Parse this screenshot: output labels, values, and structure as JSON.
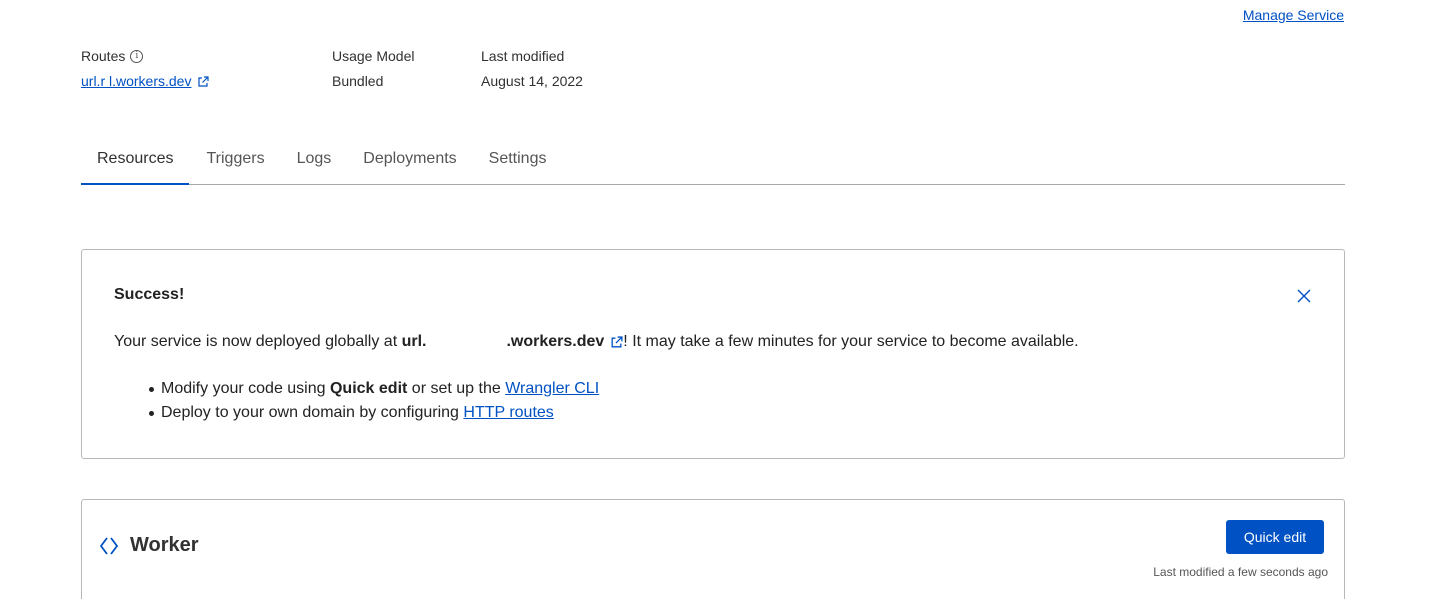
{
  "header": {
    "manage_service": "Manage Service"
  },
  "meta": {
    "routes_label": "Routes",
    "route_value": "url.r       l.workers.dev",
    "usage_label": "Usage Model",
    "usage_value": "Bundled",
    "modified_label": "Last modified",
    "modified_value": "August 14, 2022"
  },
  "tabs": [
    {
      "label": "Resources"
    },
    {
      "label": "Triggers"
    },
    {
      "label": "Logs"
    },
    {
      "label": "Deployments"
    },
    {
      "label": "Settings"
    }
  ],
  "alert": {
    "title": "Success!",
    "msg_prefix": "Your service is now deployed globally at ",
    "msg_url_a": "url.",
    "msg_url_b": ".workers.dev",
    "msg_suffix": "! It may take a few minutes for your service to become available.",
    "bullet1_a": "Modify your code using ",
    "bullet1_bold": "Quick edit",
    "bullet1_b": " or set up the ",
    "bullet1_link": "Wrangler CLI",
    "bullet2_a": "Deploy to your own domain by configuring ",
    "bullet2_link": "HTTP routes"
  },
  "worker": {
    "title": "Worker",
    "quick_edit": "Quick edit",
    "last_modified": "Last modified a few seconds ago"
  },
  "colors": {
    "accent": "#0051c3"
  }
}
